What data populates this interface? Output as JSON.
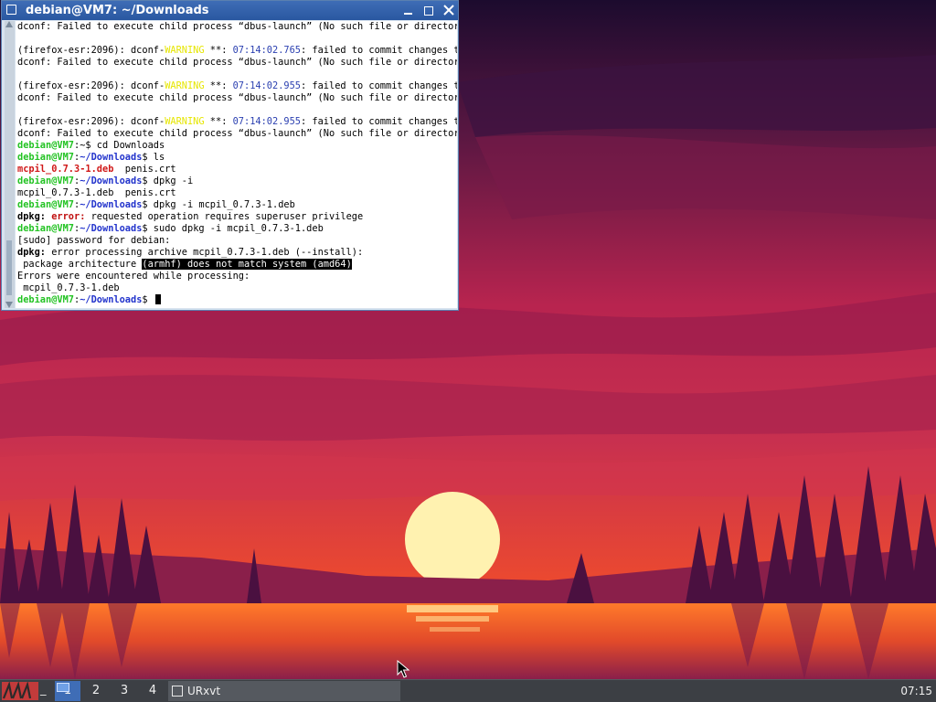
{
  "window": {
    "title": "debian@VM7: ~/Downloads"
  },
  "terminal": {
    "lines": [
      {
        "segments": [
          {
            "text": "dconf: Failed to execute child process “dbus-launch” (No such file or directory)"
          }
        ]
      },
      {
        "segments": [
          {
            "text": ""
          }
        ]
      },
      {
        "segments": [
          {
            "text": "(firefox-esr:2096): dconf-"
          },
          {
            "text": "WARNING",
            "cls": "c-warn"
          },
          {
            "text": " **: "
          },
          {
            "text": "07:14:02.765",
            "cls": "c-time"
          },
          {
            "text": ": failed to commit changes to"
          }
        ]
      },
      {
        "segments": [
          {
            "text": "dconf: Failed to execute child process “dbus-launch” (No such file or directory)"
          }
        ]
      },
      {
        "segments": [
          {
            "text": ""
          }
        ]
      },
      {
        "segments": [
          {
            "text": "(firefox-esr:2096): dconf-"
          },
          {
            "text": "WARNING",
            "cls": "c-warn"
          },
          {
            "text": " **: "
          },
          {
            "text": "07:14:02.955",
            "cls": "c-time"
          },
          {
            "text": ": failed to commit changes to"
          }
        ]
      },
      {
        "segments": [
          {
            "text": "dconf: Failed to execute child process “dbus-launch” (No such file or directory)"
          }
        ]
      },
      {
        "segments": [
          {
            "text": ""
          }
        ]
      },
      {
        "segments": [
          {
            "text": "(firefox-esr:2096): dconf-"
          },
          {
            "text": "WARNING",
            "cls": "c-warn"
          },
          {
            "text": " **: "
          },
          {
            "text": "07:14:02.955",
            "cls": "c-time"
          },
          {
            "text": ": failed to commit changes to"
          }
        ]
      },
      {
        "segments": [
          {
            "text": "dconf: Failed to execute child process “dbus-launch” (No such file or directory)"
          }
        ]
      },
      {
        "segments": [
          {
            "text": "debian@VM7",
            "cls": "c-user"
          },
          {
            "text": ":~$ cd Downloads"
          }
        ]
      },
      {
        "segments": [
          {
            "text": "debian@VM7",
            "cls": "c-user"
          },
          {
            "text": ":"
          },
          {
            "text": "~/Downloads",
            "cls": "c-path"
          },
          {
            "text": "$ ls"
          }
        ]
      },
      {
        "segments": [
          {
            "text": "mcpil_0.7.3-1.deb",
            "cls": "c-deb"
          },
          {
            "text": "  penis.crt"
          }
        ]
      },
      {
        "segments": [
          {
            "text": "debian@VM7",
            "cls": "c-user"
          },
          {
            "text": ":"
          },
          {
            "text": "~/Downloads",
            "cls": "c-path"
          },
          {
            "text": "$ dpkg -i"
          }
        ]
      },
      {
        "segments": [
          {
            "text": "mcpil_0.7.3-1.deb  penis.crt"
          }
        ]
      },
      {
        "segments": [
          {
            "text": "debian@VM7",
            "cls": "c-user"
          },
          {
            "text": ":"
          },
          {
            "text": "~/Downloads",
            "cls": "c-path"
          },
          {
            "text": "$ dpkg -i mcpil_0.7.3-1.deb"
          }
        ]
      },
      {
        "segments": [
          {
            "text": "dpkg:",
            "cls": "c-bold"
          },
          {
            "text": " "
          },
          {
            "text": "error:",
            "cls": "c-err"
          },
          {
            "text": " requested operation requires superuser privilege"
          }
        ]
      },
      {
        "segments": [
          {
            "text": "debian@VM7",
            "cls": "c-user"
          },
          {
            "text": ":"
          },
          {
            "text": "~/Downloads",
            "cls": "c-path"
          },
          {
            "text": "$ sudo dpkg -i mcpil_0.7.3-1.deb"
          }
        ]
      },
      {
        "segments": [
          {
            "text": "[sudo] password for debian:"
          }
        ]
      },
      {
        "segments": [
          {
            "text": "dpkg:",
            "cls": "c-bold"
          },
          {
            "text": " error processing archive mcpil_0.7.3-1.deb (--install):"
          }
        ]
      },
      {
        "segments": [
          {
            "text": " package architecture "
          },
          {
            "text": "(armhf) does not match system (amd64)",
            "cls": "c-sel"
          }
        ]
      },
      {
        "segments": [
          {
            "text": "Errors were encountered while processing:"
          }
        ]
      },
      {
        "segments": [
          {
            "text": " mcpil_0.7.3-1.deb"
          }
        ]
      },
      {
        "segments": [
          {
            "text": "debian@VM7",
            "cls": "c-user"
          },
          {
            "text": ":"
          },
          {
            "text": "~/Downloads",
            "cls": "c-path"
          },
          {
            "text": "$ "
          }
        ],
        "cursor": true
      }
    ]
  },
  "taskbar": {
    "show_desktop_glyph": "_",
    "workspaces": [
      "1",
      "2",
      "3",
      "4"
    ],
    "active_workspace": "1",
    "task_label": "URxvt",
    "clock": "07:15"
  },
  "colors": {
    "sky_top": "#2a0f3a",
    "sky_mid": "#b8244f",
    "horizon": "#f25a2a",
    "sun": "#fff2b0",
    "accent": "#3f6db6"
  }
}
